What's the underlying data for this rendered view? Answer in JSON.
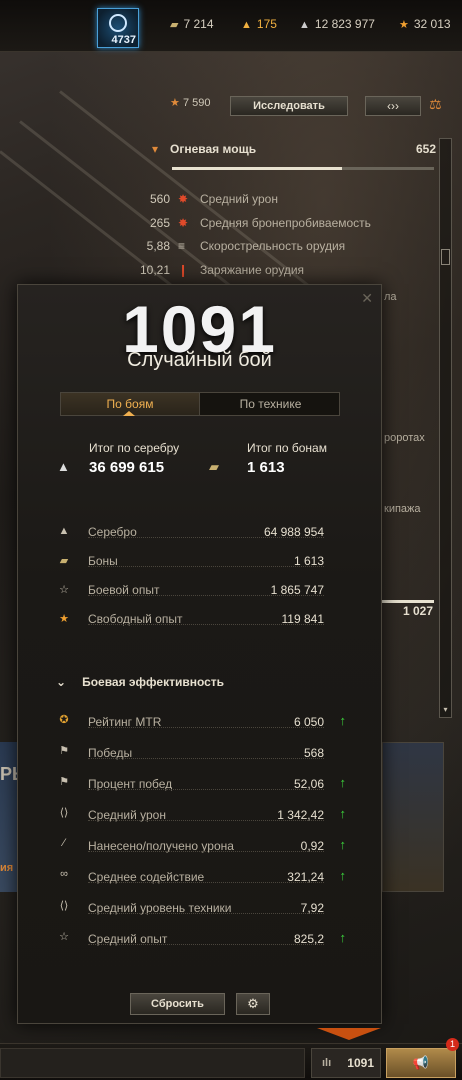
{
  "topbar": {
    "tier_value": "4737",
    "currencies": [
      {
        "icon": "bonds-icon",
        "value": "7 214"
      },
      {
        "icon": "gold-icon",
        "value": "175"
      },
      {
        "icon": "silver-icon",
        "value": "12 823 977"
      },
      {
        "icon": "free-xp-icon",
        "value": "32 013"
      }
    ]
  },
  "vehicle": {
    "xp": "7 590",
    "research_label": "Исследовать",
    "firepower_label": "Огневая мощь",
    "firepower_value": "652",
    "firepower_fill": 0.65,
    "stats": [
      {
        "value": "560",
        "label": "Средний урон"
      },
      {
        "value": "265",
        "label": "Средняя бронепробиваемость"
      },
      {
        "value": "5,88",
        "label": "Скорострельность орудия"
      },
      {
        "value": "10,21",
        "label": "Заряжание орудия"
      }
    ],
    "right_value": "1 027",
    "side_fragments": [
      "ла",
      "роротах",
      "кипажа"
    ]
  },
  "popup": {
    "big_number": "1091",
    "mode": "Случайный бой",
    "tabs": [
      "По боям",
      "По технике"
    ],
    "total_silver_label": "Итог по серебру",
    "total_silver_value": "36 699 615",
    "total_bonds_label": "Итог по бонам",
    "total_bonds_value": "1 613",
    "earnings": [
      {
        "icon": "silver-icon",
        "label": "Серебро",
        "value": "64 988 954"
      },
      {
        "icon": "bonds-icon",
        "label": "Боны",
        "value": "1 613"
      },
      {
        "icon": "xp-star-icon",
        "label": "Боевой опыт",
        "value": "1 865 747"
      },
      {
        "icon": "free-xp-icon",
        "label": "Свободный опыт",
        "value": "119 841"
      }
    ],
    "efficiency_title": "Боевая эффективность",
    "efficiency": [
      {
        "icon": "mtr-rating-icon",
        "label": "Рейтинг MTR",
        "value": "6 050",
        "up": true
      },
      {
        "icon": "flag-icon",
        "label": "Победы",
        "value": "568",
        "up": false
      },
      {
        "icon": "flag-icon",
        "label": "Процент побед",
        "value": "52,06",
        "up": true
      },
      {
        "icon": "damage-icon",
        "label": "Средний урон",
        "value": "1 342,42",
        "up": true
      },
      {
        "icon": "ratio-icon",
        "label": "Нанесено/получено урона",
        "value": "0,92",
        "up": true
      },
      {
        "icon": "assist-icon",
        "label": "Среднее содействие",
        "value": "321,24",
        "up": true
      },
      {
        "icon": "tank-tier-icon",
        "label": "Средний уровень техники",
        "value": "7,92",
        "up": false
      },
      {
        "icon": "xp-star-icon",
        "label": "Средний опыт",
        "value": "825,2",
        "up": true
      }
    ],
    "reset_label": "Сбросить"
  },
  "left_fragments": [
    "РЬ",
    "ия"
  ],
  "bottombar": {
    "battles_count": "1091",
    "notification_badge": "1"
  }
}
